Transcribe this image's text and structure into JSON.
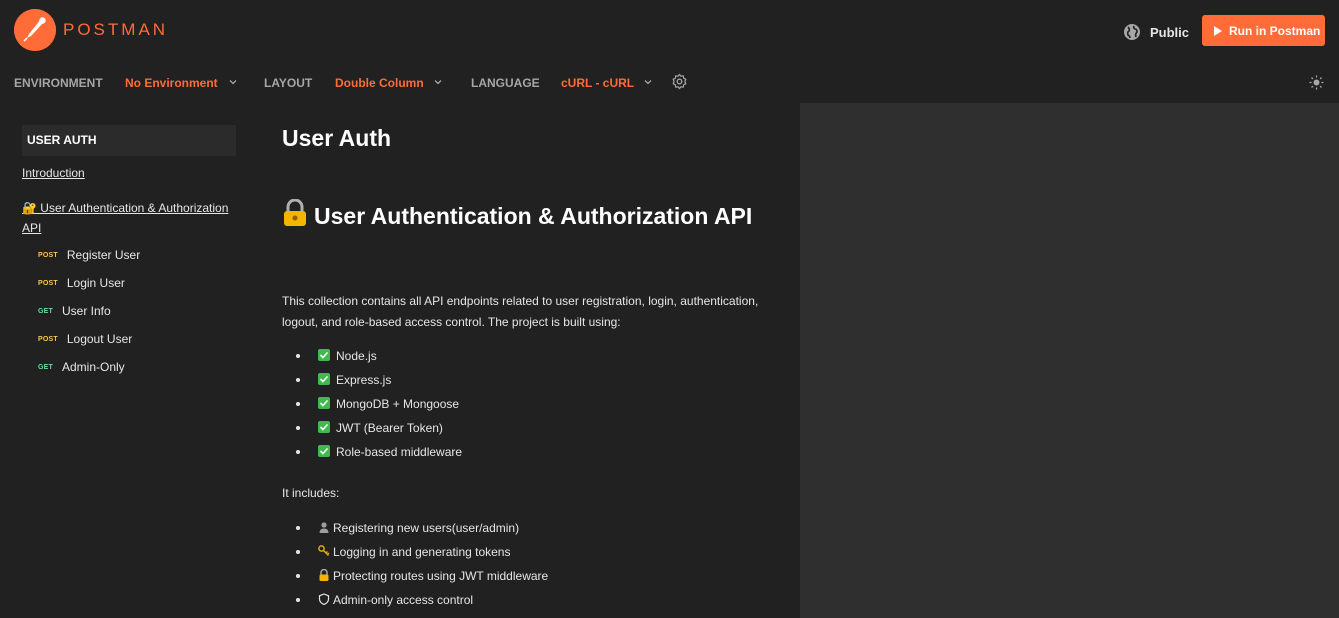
{
  "header": {
    "brand": "POSTMAN",
    "visibility": "Public",
    "run_button": "Run in Postman",
    "accent": "#ff6c37"
  },
  "toolbar": {
    "environment_label": "ENVIRONMENT",
    "environment_value": "No Environment",
    "layout_label": "LAYOUT",
    "layout_value": "Double Column",
    "language_label": "LANGUAGE",
    "language_value": "cURL - cURL"
  },
  "sidebar": {
    "title": "USER AUTH",
    "links": [
      {
        "label": "Introduction"
      },
      {
        "label": "🔐 User Authentication & Authorization API"
      }
    ],
    "requests": [
      {
        "method": "POST",
        "name": "Register User"
      },
      {
        "method": "POST",
        "name": "Login User"
      },
      {
        "method": "GET",
        "name": "User Info"
      },
      {
        "method": "POST",
        "name": "Logout User"
      },
      {
        "method": "GET",
        "name": "Admin-Only"
      }
    ]
  },
  "content": {
    "page_title": "User Auth",
    "section_title": "User Authentication & Authorization API",
    "description": "This collection contains all API endpoints related to user registration, login, authentication, logout, and role-based access control. The project is built using:",
    "tech_stack": [
      {
        "icon": "check-icon",
        "text": "Node.js"
      },
      {
        "icon": "check-icon",
        "text": "Express.js"
      },
      {
        "icon": "check-icon",
        "text": "MongoDB + Mongoose"
      },
      {
        "icon": "check-icon",
        "text": "JWT (Bearer Token)"
      },
      {
        "icon": "check-icon",
        "text": "Role-based middleware"
      }
    ],
    "includes_label": "It includes:",
    "includes": [
      {
        "icon": "person-icon",
        "text": "Registering new users(user/admin)"
      },
      {
        "icon": "key-icon",
        "text": "Logging in and generating tokens"
      },
      {
        "icon": "lock-icon",
        "text": "Protecting routes using JWT middleware"
      },
      {
        "icon": "shield-icon",
        "text": "Admin-only access control"
      }
    ]
  }
}
